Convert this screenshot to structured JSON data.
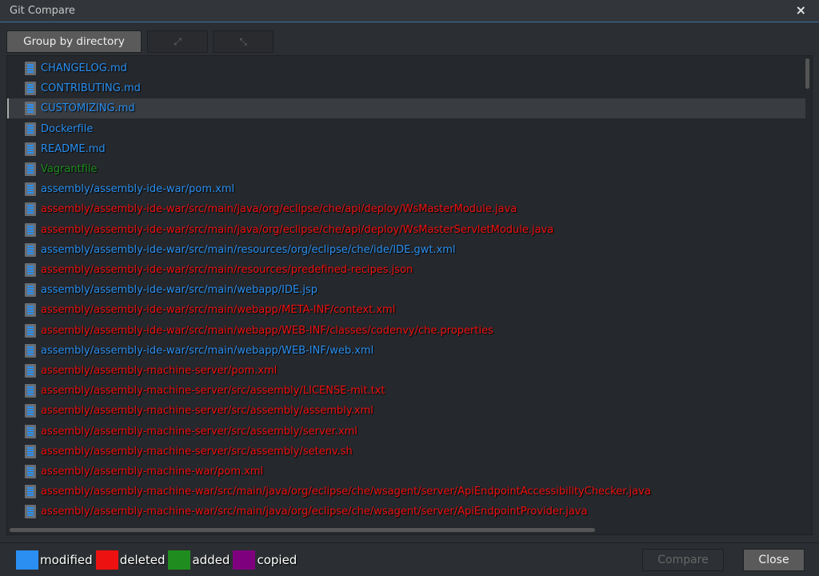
{
  "window": {
    "title": "Git Compare",
    "close_icon": "×"
  },
  "toolbar": {
    "group_label": "Group by directory",
    "expand_icon": "⤢",
    "collapse_icon": "⤡"
  },
  "colors": {
    "modified": "#2a8ff0",
    "deleted": "#ee1111",
    "added": "#1f8c1f",
    "copied": "#7f007f"
  },
  "files": [
    {
      "path": "CHANGELOG.md",
      "status": "modified"
    },
    {
      "path": "CONTRIBUTING.md",
      "status": "modified"
    },
    {
      "path": "CUSTOMIZING.md",
      "status": "modified",
      "selected": true
    },
    {
      "path": "Dockerfile",
      "status": "modified"
    },
    {
      "path": "README.md",
      "status": "modified"
    },
    {
      "path": "Vagrantfile",
      "status": "added"
    },
    {
      "path": "assembly/assembly-ide-war/pom.xml",
      "status": "modified"
    },
    {
      "path": "assembly/assembly-ide-war/src/main/java/org/eclipse/che/api/deploy/WsMasterModule.java",
      "status": "deleted"
    },
    {
      "path": "assembly/assembly-ide-war/src/main/java/org/eclipse/che/api/deploy/WsMasterServletModule.java",
      "status": "deleted"
    },
    {
      "path": "assembly/assembly-ide-war/src/main/resources/org/eclipse/che/ide/IDE.gwt.xml",
      "status": "modified"
    },
    {
      "path": "assembly/assembly-ide-war/src/main/resources/predefined-recipes.json",
      "status": "deleted"
    },
    {
      "path": "assembly/assembly-ide-war/src/main/webapp/IDE.jsp",
      "status": "modified"
    },
    {
      "path": "assembly/assembly-ide-war/src/main/webapp/META-INF/context.xml",
      "status": "deleted"
    },
    {
      "path": "assembly/assembly-ide-war/src/main/webapp/WEB-INF/classes/codenvy/che.properties",
      "status": "deleted"
    },
    {
      "path": "assembly/assembly-ide-war/src/main/webapp/WEB-INF/web.xml",
      "status": "modified"
    },
    {
      "path": "assembly/assembly-machine-server/pom.xml",
      "status": "deleted"
    },
    {
      "path": "assembly/assembly-machine-server/src/assembly/LICENSE-mit.txt",
      "status": "deleted"
    },
    {
      "path": "assembly/assembly-machine-server/src/assembly/assembly.xml",
      "status": "deleted"
    },
    {
      "path": "assembly/assembly-machine-server/src/assembly/server.xml",
      "status": "deleted"
    },
    {
      "path": "assembly/assembly-machine-server/src/assembly/setenv.sh",
      "status": "deleted"
    },
    {
      "path": "assembly/assembly-machine-war/pom.xml",
      "status": "deleted"
    },
    {
      "path": "assembly/assembly-machine-war/src/main/java/org/eclipse/che/wsagent/server/ApiEndpointAccessibilityChecker.java",
      "status": "deleted"
    },
    {
      "path": "assembly/assembly-machine-war/src/main/java/org/eclipse/che/wsagent/server/ApiEndpointProvider.java",
      "status": "deleted"
    }
  ],
  "legend": [
    {
      "label": "modified",
      "status": "modified"
    },
    {
      "label": "deleted",
      "status": "deleted"
    },
    {
      "label": "added",
      "status": "added"
    },
    {
      "label": "copied",
      "status": "copied"
    }
  ],
  "buttons": {
    "compare": "Compare",
    "close": "Close"
  }
}
